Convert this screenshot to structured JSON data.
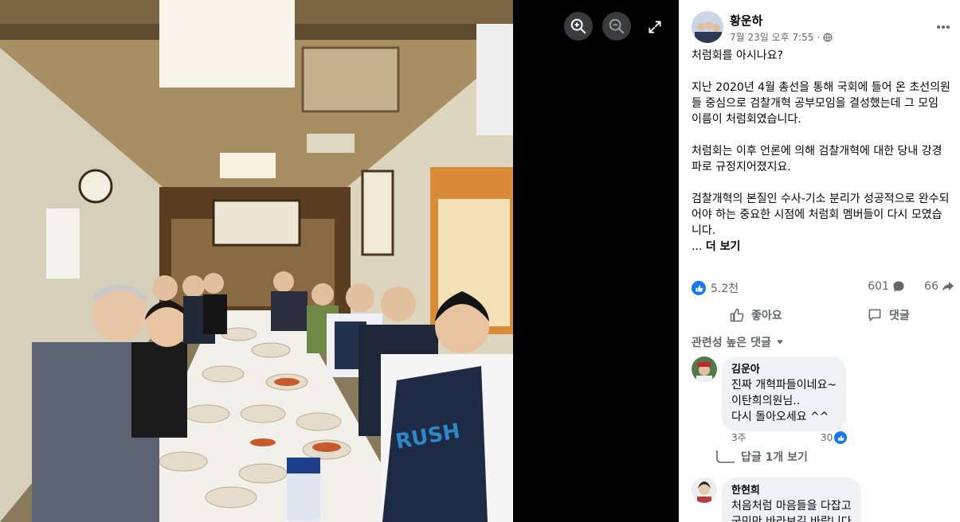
{
  "viewer": {
    "zoom_in_icon": "zoom-in-icon",
    "zoom_out_icon": "zoom-out-icon",
    "fullscreen_icon": "fullscreen-icon"
  },
  "post": {
    "author": "황운하",
    "date": "7월 23일 오후 7:55",
    "privacy_icon": "globe-icon",
    "paragraphs": [
      "처럼회를 아시나요?",
      "지난 2020년 4월 총선을 통해 국회에 들어 온 초선의원들 중심으로 검찰개혁 공부모임을 결성했는데 그 모임 이름이 처럼회였습니다.",
      "처럼회는 이후 언론에 의해 검찰개혁에 대한 당내 강경파로 규정지어졌지요.",
      "검찰개혁의 본질인 수사-기소 분리가 성공적으로 완수되어야 하는 중요한 시점에 처럼회 멤버들이 다시 모였습니다."
    ],
    "ellipsis": "...",
    "see_more": "더 보기"
  },
  "stats": {
    "likes": "5.2천",
    "comments": "601",
    "shares": "66"
  },
  "actions": {
    "like": "좋아요",
    "comment": "댓글"
  },
  "comments_section": {
    "sort_label": "관련성 높은 댓글",
    "comments": [
      {
        "name": "김운아",
        "text": "진짜 개혁파들이네요~\n이탄희의원님..\n다시 돌아오세요 ^^",
        "time": "3주",
        "likes": "30"
      },
      {
        "name": "한현희",
        "text": "처음처럼 마음들을 다잡고\n국민만 바라보길 바랍니다"
      }
    ],
    "reply_link": "답글 1개 보기"
  },
  "colors": {
    "accent": "#1877f2",
    "secondary_text": "#65676b",
    "bubble": "#f0f2f5"
  }
}
